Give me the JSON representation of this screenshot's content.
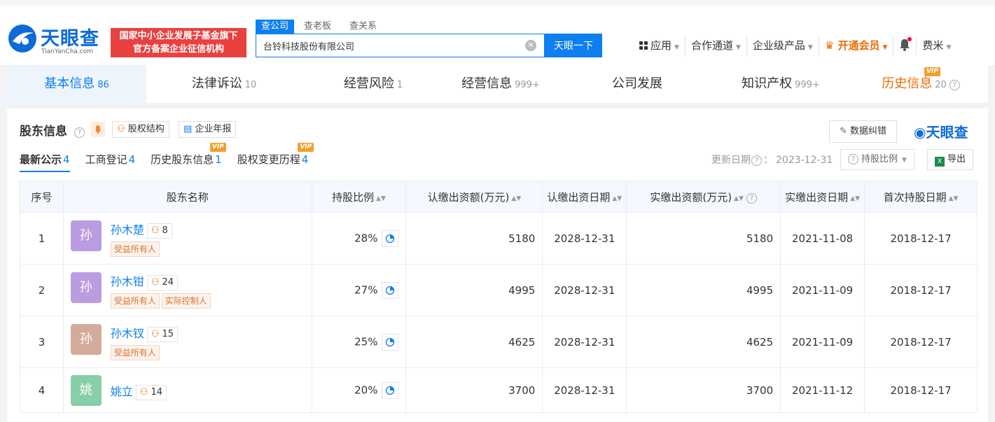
{
  "header": {
    "logo_cn": "天眼查",
    "logo_en": "TianYanCha.com",
    "banner_line1": "国家中小企业发展子基金旗下",
    "banner_line2": "官方备案企业征信机构",
    "search_tabs": [
      "查公司",
      "查老板",
      "查关系"
    ],
    "search_value": "台铃科技股份有限公司",
    "search_button": "天眼一下",
    "nav": {
      "apps": "应用",
      "channels": "合作通道",
      "enterprise": "企业级产品",
      "vip": "开通会员",
      "user": "费米"
    }
  },
  "main_tabs": [
    {
      "label": "基本信息",
      "count": "86"
    },
    {
      "label": "法律诉讼",
      "count": "10"
    },
    {
      "label": "经营风险",
      "count": "1"
    },
    {
      "label": "经营信息",
      "count": "999+"
    },
    {
      "label": "公司发展",
      "count": ""
    },
    {
      "label": "知识产权",
      "count": "999+"
    },
    {
      "label": "历史信息",
      "count": "20"
    }
  ],
  "vip_label": "VIP",
  "section": {
    "title": "股东信息",
    "equity_structure": "股权结构",
    "annual_report": "企业年报",
    "correction": "数据纠错",
    "logo": "天眼查",
    "sub_tabs": [
      {
        "label": "最新公示",
        "count": "4"
      },
      {
        "label": "工商登记",
        "count": "4"
      },
      {
        "label": "历史股东信息",
        "count": "1"
      },
      {
        "label": "股权变更历程",
        "count": "4"
      }
    ],
    "update_label": "更新日期",
    "update_date": "2023-12-31",
    "sort_by": "持股比例",
    "export": "导出"
  },
  "table": {
    "headers": [
      "序号",
      "股东名称",
      "持股比例",
      "认缴出资额(万元)",
      "认缴出资日期",
      "实缴出资额(万元)",
      "实缴出资日期",
      "首次持股日期"
    ],
    "rows": [
      {
        "idx": "1",
        "avatar": "孙",
        "avatar_color": "#b99de0",
        "name": "孙木楚",
        "links": "8",
        "tags": [
          "受益所有人"
        ],
        "ratio": "28%",
        "sub_amount": "5180",
        "sub_date": "2028-12-31",
        "paid_amount": "5180",
        "paid_date": "2021-11-08",
        "first_date": "2018-12-17"
      },
      {
        "idx": "2",
        "avatar": "孙",
        "avatar_color": "#b99de0",
        "name": "孙木钳",
        "links": "24",
        "tags": [
          "受益所有人",
          "实际控制人"
        ],
        "ratio": "27%",
        "sub_amount": "4995",
        "sub_date": "2028-12-31",
        "paid_amount": "4995",
        "paid_date": "2021-11-09",
        "first_date": "2018-12-17"
      },
      {
        "idx": "3",
        "avatar": "孙",
        "avatar_color": "#d4ab9a",
        "name": "孙木钗",
        "links": "15",
        "tags": [
          "受益所有人"
        ],
        "ratio": "25%",
        "sub_amount": "4625",
        "sub_date": "2028-12-31",
        "paid_amount": "4625",
        "paid_date": "2021-11-09",
        "first_date": "2018-12-17"
      },
      {
        "idx": "4",
        "avatar": "姚",
        "avatar_color": "#86cfa8",
        "name": "姚立",
        "links": "14",
        "tags": [],
        "ratio": "20%",
        "sub_amount": "3700",
        "sub_date": "2028-12-31",
        "paid_amount": "3700",
        "paid_date": "2021-11-12",
        "first_date": "2018-12-17"
      }
    ]
  },
  "colors": {
    "accent": "#0d7ff0",
    "vip": "#e96e06",
    "banner": "#e8413f"
  }
}
